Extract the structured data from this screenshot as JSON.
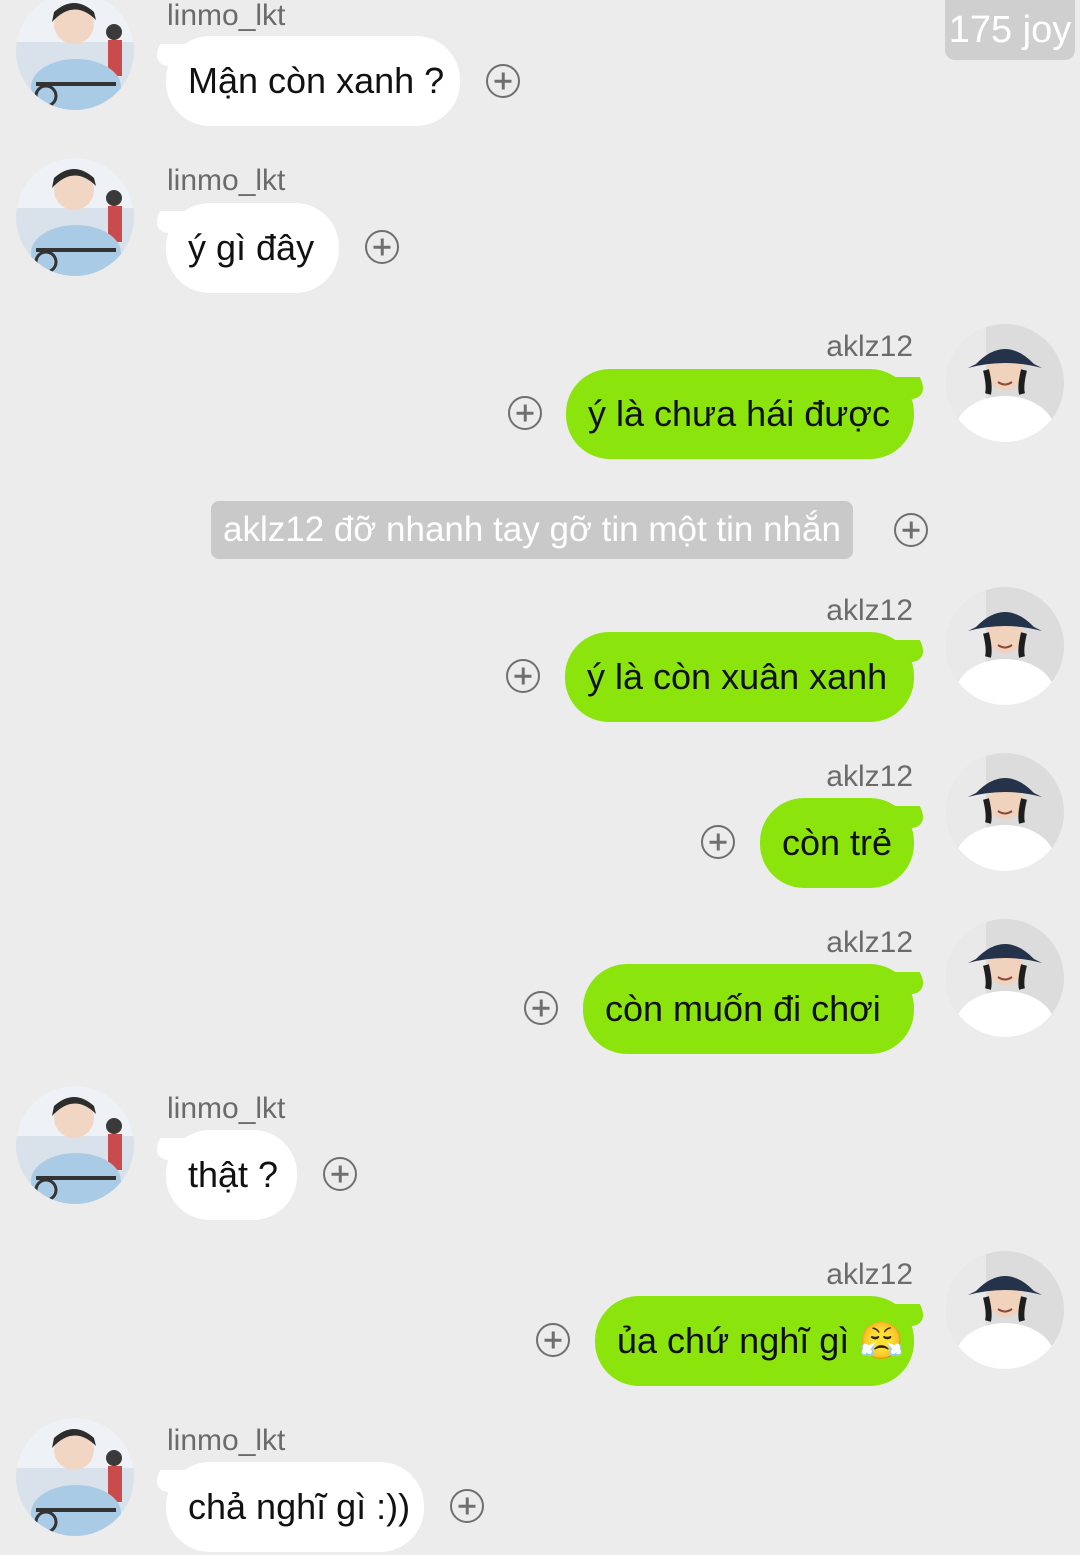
{
  "watermark": "175 joy",
  "users": {
    "left": "linmo_lkt",
    "right": "aklz12"
  },
  "messages": [
    {
      "sender": "linmo_lkt",
      "text": "Mận còn xanh ?"
    },
    {
      "sender": "linmo_lkt",
      "text": "ý gì đây"
    },
    {
      "sender": "aklz12",
      "text": "ý là chưa hái được"
    },
    {
      "sender": "aklz12",
      "text": "ý là còn xuân xanh"
    },
    {
      "sender": "aklz12",
      "text": "còn trẻ"
    },
    {
      "sender": "aklz12",
      "text": "còn muốn đi chơi"
    },
    {
      "sender": "linmo_lkt",
      "text": "thật ?"
    },
    {
      "sender": "aklz12",
      "text": "ủa chứ nghĩ gì 😤"
    },
    {
      "sender": "linmo_lkt",
      "text": "chả nghĩ gì :))"
    }
  ],
  "system_notice": "aklz12 đỡ nhanh tay gỡ tin một tin nhắn",
  "icons": {
    "add_reaction": "plus-circle-icon",
    "avatar_left": "avatar-linmo",
    "avatar_right": "avatar-aklz12"
  },
  "colors": {
    "background": "#ececec",
    "incoming_bubble": "#ffffff",
    "outgoing_bubble": "#8ce40d"
  }
}
